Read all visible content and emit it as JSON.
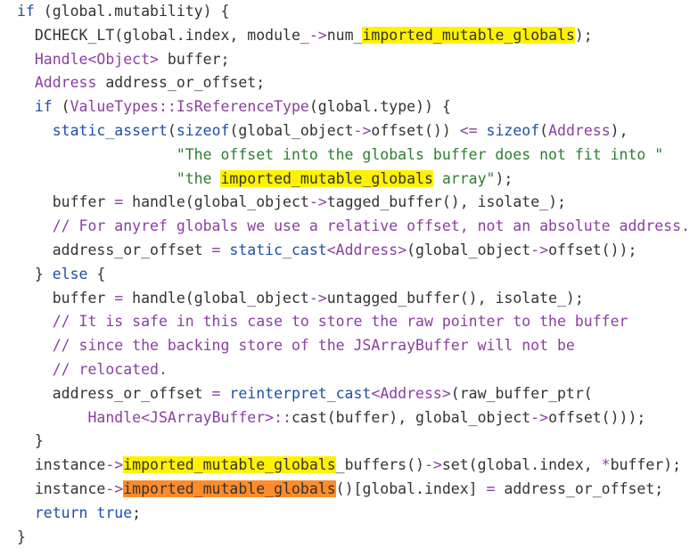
{
  "lines": [
    [
      {
        "t": "if",
        "c": "kw"
      },
      {
        "t": " (global.mutability) {"
      }
    ],
    [
      {
        "t": "  DCHECK_LT(global.index, module_"
      },
      {
        "t": "->",
        "c": "op"
      },
      {
        "t": "num_"
      },
      {
        "t": "imported_mutable_globals",
        "h": "y"
      },
      {
        "t": ");"
      }
    ],
    [
      {
        "t": "  "
      },
      {
        "t": "Handle",
        "c": "ty"
      },
      {
        "t": "<",
        "c": "op"
      },
      {
        "t": "Object",
        "c": "ty"
      },
      {
        "t": ">",
        "c": "op"
      },
      {
        "t": " buffer;"
      }
    ],
    [
      {
        "t": "  "
      },
      {
        "t": "Address",
        "c": "ty"
      },
      {
        "t": " address_or_offset;"
      }
    ],
    [
      {
        "t": "  "
      },
      {
        "t": "if",
        "c": "kw"
      },
      {
        "t": " ("
      },
      {
        "t": "ValueTypes",
        "c": "ty"
      },
      {
        "t": "::",
        "c": "op"
      },
      {
        "t": "IsReferenceType",
        "c": "ty"
      },
      {
        "t": "(global.type)) {"
      }
    ],
    [
      {
        "t": "    "
      },
      {
        "t": "static_assert",
        "c": "kw"
      },
      {
        "t": "("
      },
      {
        "t": "sizeof",
        "c": "kw"
      },
      {
        "t": "(global_object"
      },
      {
        "t": "->",
        "c": "op"
      },
      {
        "t": "offset()) "
      },
      {
        "t": "<=",
        "c": "op"
      },
      {
        "t": " "
      },
      {
        "t": "sizeof",
        "c": "kw"
      },
      {
        "t": "("
      },
      {
        "t": "Address",
        "c": "ty"
      },
      {
        "t": "),"
      }
    ],
    [
      {
        "t": "                  "
      },
      {
        "t": "\"The offset into the globals buffer does not fit into \"",
        "c": "str"
      }
    ],
    [
      {
        "t": "                  "
      },
      {
        "t": "\"the ",
        "c": "str"
      },
      {
        "t": "imported_mutable_globals",
        "h": "y"
      },
      {
        "t": " array\"",
        "c": "str"
      },
      {
        "t": ");"
      }
    ],
    [
      {
        "t": "    buffer "
      },
      {
        "t": "=",
        "c": "op"
      },
      {
        "t": " handle(global_object"
      },
      {
        "t": "->",
        "c": "op"
      },
      {
        "t": "tagged_buffer(), isolate_);"
      }
    ],
    [
      {
        "t": "    "
      },
      {
        "t": "// For anyref globals we use a relative offset, not an absolute address.",
        "c": "cm"
      }
    ],
    [
      {
        "t": "    address_or_offset "
      },
      {
        "t": "=",
        "c": "op"
      },
      {
        "t": " "
      },
      {
        "t": "static_cast",
        "c": "kw"
      },
      {
        "t": "<",
        "c": "op"
      },
      {
        "t": "Address",
        "c": "ty"
      },
      {
        "t": ">",
        "c": "op"
      },
      {
        "t": "(global_object"
      },
      {
        "t": "->",
        "c": "op"
      },
      {
        "t": "offset());"
      }
    ],
    [
      {
        "t": "  } "
      },
      {
        "t": "else",
        "c": "kw"
      },
      {
        "t": " {"
      }
    ],
    [
      {
        "t": "    buffer "
      },
      {
        "t": "=",
        "c": "op"
      },
      {
        "t": " handle(global_object"
      },
      {
        "t": "->",
        "c": "op"
      },
      {
        "t": "untagged_buffer(), isolate_);"
      }
    ],
    [
      {
        "t": "    "
      },
      {
        "t": "// It is safe in this case to store the raw pointer to the buffer",
        "c": "cm"
      }
    ],
    [
      {
        "t": "    "
      },
      {
        "t": "// since the backing store of the JSArrayBuffer will not be",
        "c": "cm"
      }
    ],
    [
      {
        "t": "    "
      },
      {
        "t": "// relocated.",
        "c": "cm"
      }
    ],
    [
      {
        "t": "    address_or_offset "
      },
      {
        "t": "=",
        "c": "op"
      },
      {
        "t": " "
      },
      {
        "t": "reinterpret_cast",
        "c": "kw"
      },
      {
        "t": "<",
        "c": "op"
      },
      {
        "t": "Address",
        "c": "ty"
      },
      {
        "t": ">",
        "c": "op"
      },
      {
        "t": "(raw_buffer_ptr("
      }
    ],
    [
      {
        "t": "        "
      },
      {
        "t": "Handle",
        "c": "ty"
      },
      {
        "t": "<",
        "c": "op"
      },
      {
        "t": "JSArrayBuffer",
        "c": "ty"
      },
      {
        "t": ">",
        "c": "op"
      },
      {
        "t": "::",
        "c": "op"
      },
      {
        "t": "cast(buffer), global_object"
      },
      {
        "t": "->",
        "c": "op"
      },
      {
        "t": "offset()));"
      }
    ],
    [
      {
        "t": "  }"
      }
    ],
    [
      {
        "t": "  instance"
      },
      {
        "t": "->",
        "c": "op"
      },
      {
        "t": "imported_mutable_globals",
        "h": "y"
      },
      {
        "t": "_buffers()"
      },
      {
        "t": "->",
        "c": "op"
      },
      {
        "t": "set(global.index, "
      },
      {
        "t": "*",
        "c": "op"
      },
      {
        "t": "buffer);"
      }
    ],
    [
      {
        "t": "  instance"
      },
      {
        "t": "->",
        "c": "op"
      },
      {
        "t": "imported_mutable_globals",
        "h": "o"
      },
      {
        "t": "()[global.index] "
      },
      {
        "t": "=",
        "c": "op"
      },
      {
        "t": " address_or_offset;"
      }
    ],
    [
      {
        "t": "  "
      },
      {
        "t": "return",
        "c": "kw"
      },
      {
        "t": " "
      },
      {
        "t": "true",
        "c": "kw"
      },
      {
        "t": ";"
      }
    ],
    [
      {
        "t": "}"
      }
    ]
  ]
}
